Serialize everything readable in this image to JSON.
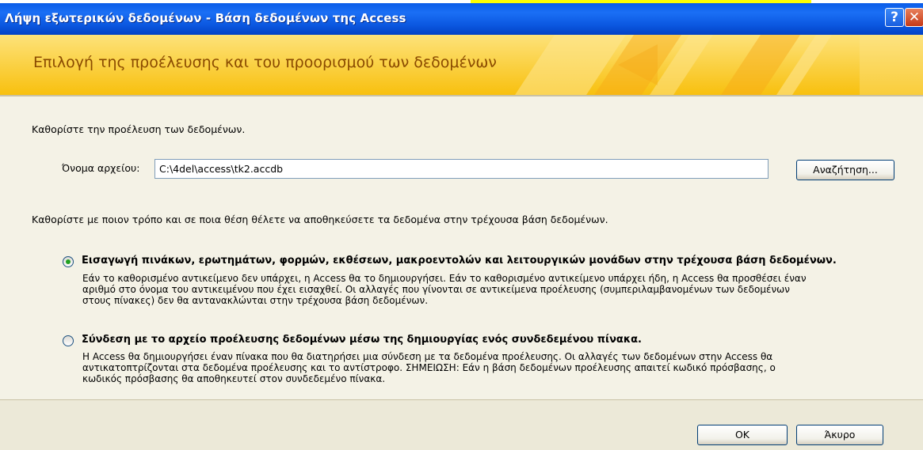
{
  "window": {
    "title": "Λήψη εξωτερικών δεδομένων - Βάση δεδομένων της Access",
    "help_glyph": "?",
    "close_glyph": "✕"
  },
  "banner": {
    "heading": "Επιλογή της προέλευσης και του προορισμού των δεδομένων"
  },
  "source": {
    "prompt": "Καθορίστε την προέλευση των δεδομένων.",
    "filename_label": "Όνομα αρχείου:",
    "filename_value": "C:\\4del\\access\\tk2.accdb",
    "browse_label": "Αναζήτηση..."
  },
  "destination": {
    "prompt": "Καθορίστε με ποιον τρόπο και σε ποια θέση θέλετε να αποθηκεύσετε τα δεδομένα στην τρέχουσα βάση δεδομένων."
  },
  "options": [
    {
      "title": "Εισαγωγή πινάκων, ερωτημάτων, φορμών, εκθέσεων, μακροεντολών και λειτουργικών μονάδων στην τρέχουσα βάση δεδομένων.",
      "desc1": "Εάν το καθορισμένο αντικείμενο δεν υπάρχει, η Access θα το δημιουργήσει. Εάν το καθορισμένο αντικείμενο υπάρχει ήδη, η Access θα προσθέσει έναν",
      "desc2": "αριθμό στο όνομα του αντικειμένου που έχει εισαχθεί. Οι αλλαγές που γίνονται σε αντικείμενα προέλευσης (συμπεριλαμβανομένων των δεδομένων",
      "desc3": "στους πίνακες) δεν θα αντανακλώνται στην τρέχουσα βάση δεδομένων.",
      "selected": true
    },
    {
      "title": "Σύνδεση με το αρχείο προέλευσης δεδομένων μέσω της δημιουργίας ενός συνδεδεμένου πίνακα.",
      "desc1": "Η Access θα δημιουργήσει έναν πίνακα που θα διατηρήσει μια σύνδεση με τα δεδομένα προέλευσης. Οι αλλαγές των δεδομένων στην Access θα",
      "desc2": "αντικατοπτρίζονται στα δεδομένα προέλευσης και το αντίστροφο. ΣΗΜΕΙΩΣΗ: Εάν η βάση δεδομένων προέλευσης απαιτεί κωδικό πρόσβασης, ο",
      "desc3": "κωδικός πρόσβασης θα αποθηκευτεί στον συνδεδεμένο πίνακα.",
      "selected": false
    }
  ],
  "footer": {
    "ok_label": "OK",
    "cancel_label": "Άκυρο"
  },
  "colors": {
    "titlebar": "#0b57e0",
    "banner": "#fbcd1c",
    "banner_text": "#8a4a00",
    "body": "#f4f2e6"
  }
}
